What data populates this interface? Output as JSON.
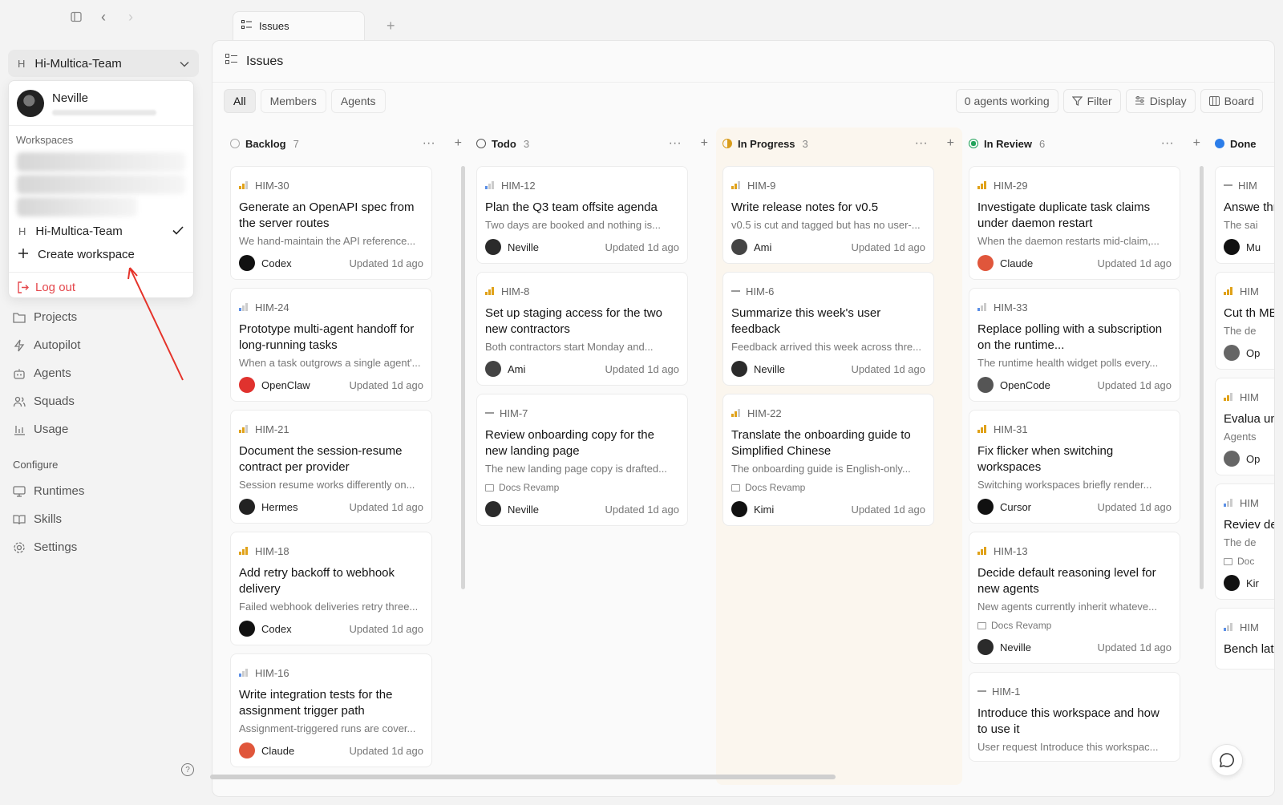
{
  "nav": {
    "back": "‹",
    "forward": "›"
  },
  "tab": {
    "label": "Issues",
    "add": "+"
  },
  "header": {
    "title": "Issues"
  },
  "filters": {
    "all": "All",
    "members": "Members",
    "agents": "Agents"
  },
  "toolbar": {
    "agents_working": "0 agents working",
    "filter": "Filter",
    "display": "Display",
    "board": "Board"
  },
  "workspace_switcher": {
    "letter": "H",
    "name": "Hi-Multica-Team"
  },
  "dropdown": {
    "user_name": "Neville",
    "workspaces_label": "Workspaces",
    "current_workspace_letter": "H",
    "current_workspace": "Hi-Multica-Team",
    "create_workspace": "Create workspace",
    "log_out": "Log out"
  },
  "sidebar": {
    "items": [
      {
        "label": "Projects",
        "icon": "folder-icon"
      },
      {
        "label": "Autopilot",
        "icon": "lightning-icon"
      },
      {
        "label": "Agents",
        "icon": "robot-icon"
      },
      {
        "label": "Squads",
        "icon": "users-icon"
      },
      {
        "label": "Usage",
        "icon": "bar-chart-icon"
      }
    ],
    "configure_label": "Configure",
    "configure_items": [
      {
        "label": "Runtimes",
        "icon": "monitor-icon"
      },
      {
        "label": "Skills",
        "icon": "book-icon"
      },
      {
        "label": "Settings",
        "icon": "gear-icon"
      }
    ]
  },
  "columns": [
    {
      "name": "Backlog",
      "count": "7",
      "status": "backlog",
      "cards": [
        {
          "id": "HIM-30",
          "prio": "medium",
          "title": "Generate an OpenAPI spec from the server routes",
          "desc": "We hand-maintain the API reference...",
          "assignee": "Codex",
          "updated": "Updated 1d ago"
        },
        {
          "id": "HIM-24",
          "prio": "low",
          "title": "Prototype multi-agent handoff for long-running tasks",
          "desc": "When a task outgrows a single agent'...",
          "assignee": "OpenClaw",
          "updated": "Updated 1d ago"
        },
        {
          "id": "HIM-21",
          "prio": "medium",
          "title": "Document the session-resume contract per provider",
          "desc": "Session resume works differently on...",
          "assignee": "Hermes",
          "updated": "Updated 1d ago"
        },
        {
          "id": "HIM-18",
          "prio": "high",
          "title": "Add retry backoff to webhook delivery",
          "desc": "Failed webhook deliveries retry three...",
          "assignee": "Codex",
          "updated": "Updated 1d ago"
        },
        {
          "id": "HIM-16",
          "prio": "low",
          "title": "Write integration tests for the assignment trigger path",
          "desc": "Assignment-triggered runs are cover...",
          "assignee": "Claude",
          "updated": "Updated 1d ago"
        }
      ]
    },
    {
      "name": "Todo",
      "count": "3",
      "status": "todo",
      "cards": [
        {
          "id": "HIM-12",
          "prio": "low",
          "title": "Plan the Q3 team offsite agenda",
          "desc": "Two days are booked and nothing is...",
          "assignee": "Neville",
          "updated": "Updated 1d ago"
        },
        {
          "id": "HIM-8",
          "prio": "high",
          "title": "Set up staging access for the two new contractors",
          "desc": "Both contractors start Monday and...",
          "assignee": "Ami",
          "updated": "Updated 1d ago"
        },
        {
          "id": "HIM-7",
          "prio": "none",
          "title": "Review onboarding copy for the new landing page",
          "desc": "The new landing page copy is drafted...",
          "project": "Docs Revamp",
          "assignee": "Neville",
          "updated": "Updated 1d ago"
        }
      ]
    },
    {
      "name": "In Progress",
      "count": "3",
      "status": "prog",
      "cards": [
        {
          "id": "HIM-9",
          "prio": "medium",
          "title": "Write release notes for v0.5",
          "desc": "v0.5 is cut and tagged but has no user-...",
          "assignee": "Ami",
          "updated": "Updated 1d ago"
        },
        {
          "id": "HIM-6",
          "prio": "none",
          "title": "Summarize this week's user feedback",
          "desc": "Feedback arrived this week across thre...",
          "assignee": "Neville",
          "updated": "Updated 1d ago"
        },
        {
          "id": "HIM-22",
          "prio": "medium",
          "title": "Translate the onboarding guide to Simplified Chinese",
          "desc": "The onboarding guide is English-only...",
          "project": "Docs Revamp",
          "assignee": "Kimi",
          "updated": "Updated 1d ago"
        }
      ]
    },
    {
      "name": "In Review",
      "count": "6",
      "status": "review",
      "cards": [
        {
          "id": "HIM-29",
          "prio": "high",
          "title": "Investigate duplicate task claims under daemon restart",
          "desc": "When the daemon restarts mid-claim,...",
          "assignee": "Claude",
          "updated": "Updated 1d ago"
        },
        {
          "id": "HIM-33",
          "prio": "low",
          "title": "Replace polling with a subscription on the runtime...",
          "desc": "The runtime health widget polls every...",
          "assignee": "OpenCode",
          "updated": "Updated 1d ago"
        },
        {
          "id": "HIM-31",
          "prio": "high",
          "title": "Fix flicker when switching workspaces",
          "desc": "Switching workspaces briefly render...",
          "assignee": "Cursor",
          "updated": "Updated 1d ago"
        },
        {
          "id": "HIM-13",
          "prio": "high",
          "title": "Decide default reasoning level for new agents",
          "desc": "New agents currently inherit whateve...",
          "project": "Docs Revamp",
          "assignee": "Neville",
          "updated": "Updated 1d ago"
        },
        {
          "id": "HIM-1",
          "prio": "none",
          "title": "Introduce this workspace and how to use it",
          "desc": "User request Introduce this workspac...",
          "assignee": "",
          "updated": ""
        }
      ]
    },
    {
      "name": "Done",
      "count": "",
      "status": "done",
      "cards": [
        {
          "id": "HIM",
          "prio": "none",
          "title": "Answe threac",
          "desc": "The sai",
          "assignee": "Mu",
          "updated": ""
        },
        {
          "id": "HIM",
          "prio": "high",
          "title": "Cut th MB",
          "desc": "The de",
          "assignee": "Op",
          "updated": ""
        },
        {
          "id": "HIM",
          "prio": "medium",
          "title": "Evalua untrus",
          "desc": "Agents",
          "assignee": "Op",
          "updated": ""
        },
        {
          "id": "HIM",
          "prio": "low",
          "title": "Reviev deskto",
          "desc": "The de",
          "project": "Doc",
          "assignee": "Kir",
          "updated": ""
        },
        {
          "id": "HIM",
          "prio": "low",
          "title": "Bench latenc",
          "desc": "",
          "assignee": "",
          "updated": ""
        }
      ]
    }
  ],
  "avatar_colors": {
    "Codex": "#111111",
    "OpenClaw": "#e0322e",
    "Hermes": "#222222",
    "Claude": "#e0563b",
    "Neville": "#2b2b2b",
    "Ami": "#444444",
    "Kimi": "#111111",
    "OpenCode": "#555555",
    "Cursor": "#111111",
    "Mu": "#111111",
    "Op": "#666666",
    "Kir": "#111111"
  },
  "accent_colors": {
    "logout": "#e5484d",
    "annotation_arrow": "#e5332a"
  }
}
